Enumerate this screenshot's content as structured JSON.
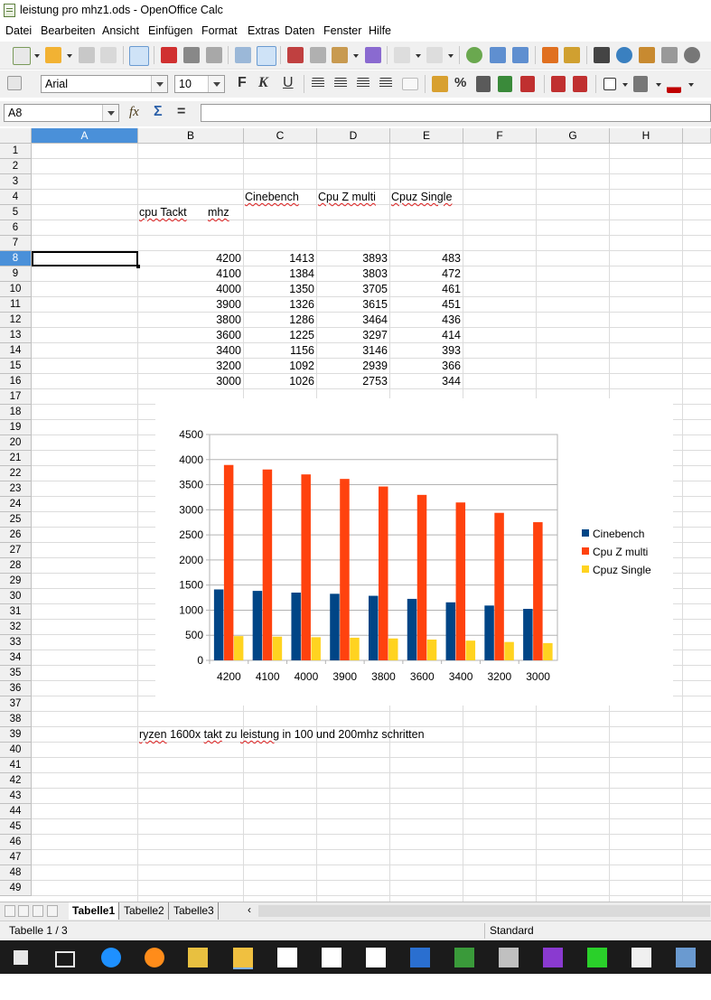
{
  "window": {
    "title": "leistung pro mhz1.ods - OpenOffice Calc"
  },
  "menu": [
    "Datei",
    "Bearbeiten",
    "Ansicht",
    "Einfügen",
    "Format",
    "Extras",
    "Daten",
    "Fenster",
    "Hilfe"
  ],
  "formatting": {
    "font_name": "Arial",
    "font_size": "10",
    "bold": "F",
    "italic": "K",
    "underline": "U",
    "percent": "%"
  },
  "formula_bar": {
    "name_box": "A8",
    "function_icon": "fx",
    "sum_icon": "Σ",
    "equals": "=",
    "content": ""
  },
  "columns": [
    "A",
    "B",
    "C",
    "D",
    "E",
    "F",
    "G",
    "H"
  ],
  "rows": [
    "1",
    "2",
    "3",
    "4",
    "5",
    "6",
    "7",
    "8",
    "9",
    "10",
    "11",
    "12",
    "13",
    "14",
    "15",
    "16",
    "17",
    "18",
    "19",
    "20",
    "21",
    "22",
    "23",
    "24",
    "25",
    "26",
    "27",
    "28",
    "29",
    "30",
    "31",
    "32",
    "33",
    "34",
    "35",
    "36",
    "37",
    "38",
    "39",
    "40",
    "41",
    "42",
    "43",
    "44",
    "45",
    "46",
    "47",
    "48",
    "49"
  ],
  "selected": {
    "column": "A",
    "row": "8"
  },
  "sheet": {
    "headers": {
      "c": "Cinebench",
      "d": "Cpu Z multi",
      "e": "Cpuz Single"
    },
    "b5_part1": "cpu Tackt",
    "b5_part2": "mhz",
    "data": [
      [
        "4200",
        "1413",
        "3893",
        "483"
      ],
      [
        "4100",
        "1384",
        "3803",
        "472"
      ],
      [
        "4000",
        "1350",
        "3705",
        "461"
      ],
      [
        "3900",
        "1326",
        "3615",
        "451"
      ],
      [
        "3800",
        "1286",
        "3464",
        "436"
      ],
      [
        "3600",
        "1225",
        "3297",
        "414"
      ],
      [
        "3400",
        "1156",
        "3146",
        "393"
      ],
      [
        "3200",
        "1092",
        "2939",
        "366"
      ],
      [
        "3000",
        "1026",
        "2753",
        "344"
      ]
    ],
    "note_parts": [
      "ryzen",
      "1600x",
      "takt",
      "zu",
      "leistung",
      "in 100 und 200mhz schritten"
    ]
  },
  "chart_data": {
    "type": "bar",
    "categories": [
      "4200",
      "4100",
      "4000",
      "3900",
      "3800",
      "3600",
      "3400",
      "3200",
      "3000"
    ],
    "series": [
      {
        "name": "Cinebench",
        "color": "#004586",
        "values": [
          1413,
          1384,
          1350,
          1326,
          1286,
          1225,
          1156,
          1092,
          1026
        ]
      },
      {
        "name": "Cpu Z multi",
        "color": "#ff420e",
        "values": [
          3893,
          3803,
          3705,
          3615,
          3464,
          3297,
          3146,
          2939,
          2753
        ]
      },
      {
        "name": "Cpuz Single",
        "color": "#ffd320",
        "values": [
          483,
          472,
          461,
          451,
          436,
          414,
          393,
          366,
          344
        ]
      }
    ],
    "ylim": [
      0,
      4500
    ],
    "yticks": [
      "0",
      "500",
      "1000",
      "1500",
      "2000",
      "2500",
      "3000",
      "3500",
      "4000",
      "4500"
    ],
    "grid": true,
    "legend": "right"
  },
  "sheet_tabs": [
    "Tabelle1",
    "Tabelle2",
    "Tabelle3"
  ],
  "status": {
    "sheet_info": "Tabelle 1 / 3",
    "style": "Standard"
  },
  "taskbar_icons": [
    "windows-start-icon",
    "task-view-icon",
    "edge-icon",
    "firefox-icon",
    "tool-icon",
    "file-explorer-icon",
    "store-icon",
    "mail-icon",
    "steam-icon",
    "app-icon",
    "gpu-icon",
    "cpu-icon",
    "cpu-z-icon",
    "number-icon",
    "pencil-app-icon",
    "speaker-app-icon"
  ]
}
